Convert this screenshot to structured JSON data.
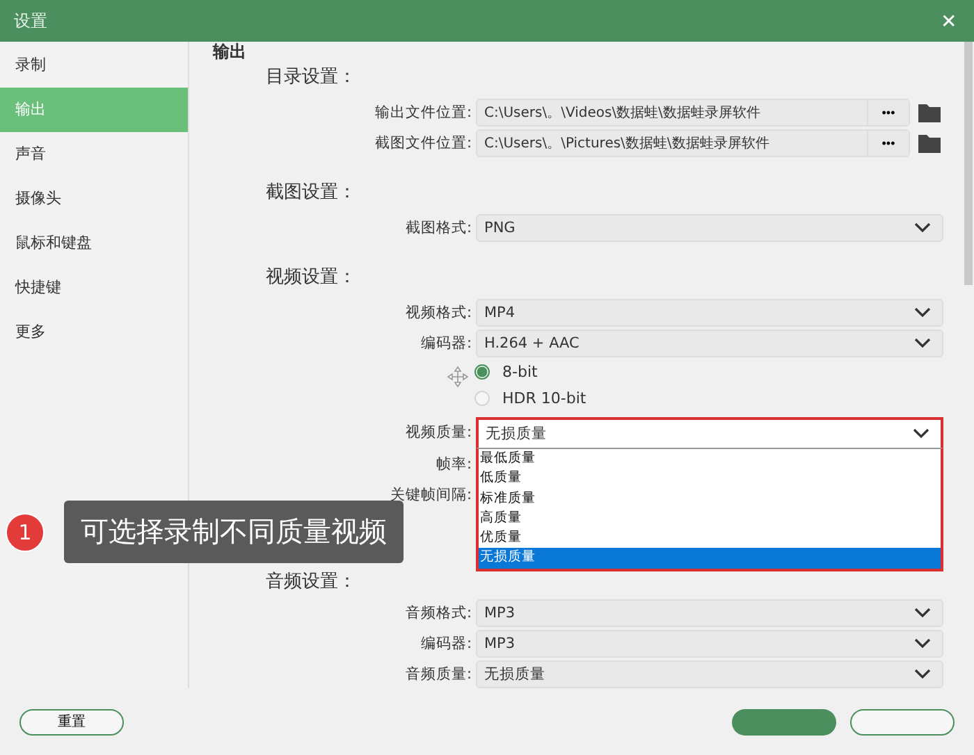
{
  "window": {
    "title": "设置",
    "close": "✕"
  },
  "sidebar": {
    "items": [
      {
        "label": "录制",
        "selected": false
      },
      {
        "label": "输出",
        "selected": true
      },
      {
        "label": "声音",
        "selected": false
      },
      {
        "label": "摄像头",
        "selected": false
      },
      {
        "label": "鼠标和键盘",
        "selected": false
      },
      {
        "label": "快捷键",
        "selected": false
      },
      {
        "label": "更多",
        "selected": false
      }
    ]
  },
  "page_heading": "输出",
  "sections": [
    {
      "title": "目录设置：",
      "rows": [
        {
          "kind": "path",
          "label": "输出文件位置:",
          "value": "C:\\Users\\。\\Videos\\数据蛙\\数据蛙录屏软件",
          "button": "•••"
        },
        {
          "kind": "path",
          "label": "截图文件位置:",
          "value": "C:\\Users\\。\\Pictures\\数据蛙\\数据蛙录屏软件",
          "button": "•••"
        }
      ]
    },
    {
      "title": "截图设置：",
      "rows": [
        {
          "kind": "select",
          "label": "截图格式:",
          "value": "PNG"
        }
      ]
    },
    {
      "title": "视频设置：",
      "rows": [
        {
          "kind": "select",
          "label": "视频格式:",
          "value": "MP4"
        },
        {
          "kind": "select",
          "label": "编码器:",
          "value": "H.264 + AAC"
        },
        {
          "kind": "radio",
          "label": "8-bit",
          "selected": true
        },
        {
          "kind": "radio",
          "label": "HDR 10-bit",
          "selected": false
        },
        {
          "kind": "dropdown",
          "label": "视频质量:",
          "value": "无损质量",
          "expanded": true,
          "options": [
            {
              "label": "最低质量",
              "selected": false
            },
            {
              "label": "低质量",
              "selected": false
            },
            {
              "label": "标准质量",
              "selected": false
            },
            {
              "label": "高质量",
              "selected": false
            },
            {
              "label": "优质量",
              "selected": false
            },
            {
              "label": "无损质量",
              "selected": true
            }
          ]
        },
        {
          "kind": "label",
          "label": "帧率:"
        },
        {
          "kind": "label",
          "label": "关键帧间隔:"
        }
      ]
    },
    {
      "title": "音频设置：",
      "rows": [
        {
          "kind": "select",
          "label": "音频格式:",
          "value": "MP3"
        },
        {
          "kind": "select",
          "label": "编码器:",
          "value": "MP3"
        },
        {
          "kind": "select",
          "label": "音频质量:",
          "value": "无损质量"
        }
      ]
    }
  ],
  "callout": {
    "number": "1",
    "text": "可选择录制不同质量视频"
  },
  "footer": {
    "reset": "重置"
  }
}
